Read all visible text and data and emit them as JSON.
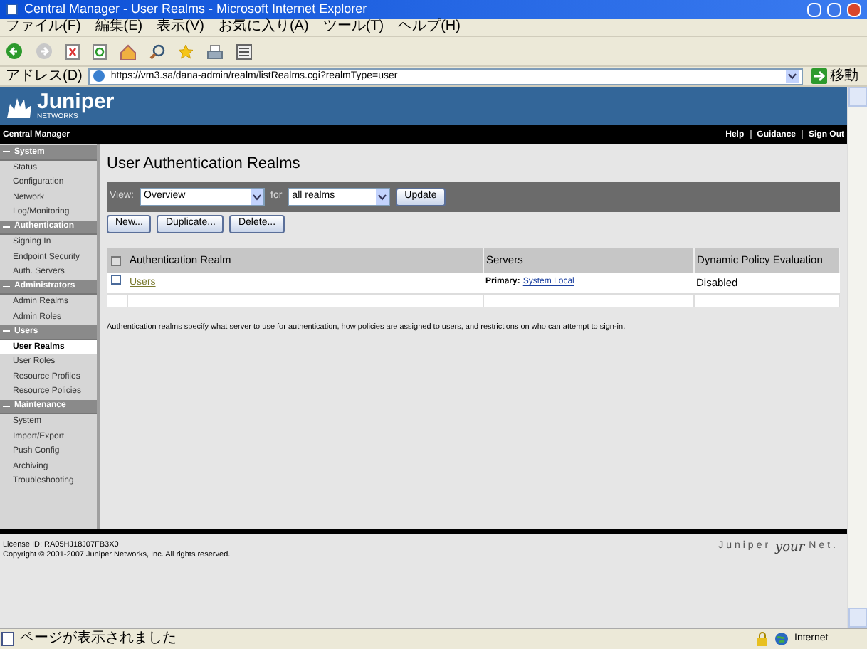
{
  "window": {
    "title": "Central Manager - User Realms - Microsoft Internet Explorer"
  },
  "menu_bar": [
    "ファイル(F)",
    "編集(E)",
    "表示(V)",
    "お気に入り(A)",
    "ツール(T)",
    "ヘルプ(H)"
  ],
  "address_bar": {
    "label": "アドレス(D)",
    "url": "https://vm3.sa/dana-admin/realm/listRealms.cgi?realmType=user",
    "go": "移動"
  },
  "header": {
    "logo": "Juniper",
    "logo_sub": "NETWORKS"
  },
  "nav_bar": {
    "title": "Central Manager",
    "links": [
      "Help",
      "Guidance",
      "Sign Out"
    ]
  },
  "sidebar": {
    "sections": [
      {
        "title": "System",
        "items": [
          {
            "label": "Status",
            "selected": false
          },
          {
            "label": "Configuration",
            "selected": false
          },
          {
            "label": "Network",
            "selected": false
          },
          {
            "label": "Log/Monitoring",
            "selected": false
          }
        ]
      },
      {
        "title": "Authentication",
        "items": [
          {
            "label": "Signing In",
            "selected": false
          },
          {
            "label": "Endpoint Security",
            "selected": false
          },
          {
            "label": "Auth. Servers",
            "selected": false
          }
        ]
      },
      {
        "title": "Administrators",
        "items": [
          {
            "label": "Admin Realms",
            "selected": false
          },
          {
            "label": "Admin Roles",
            "selected": false
          }
        ]
      },
      {
        "title": "Users",
        "items": [
          {
            "label": "User Realms",
            "selected": true
          },
          {
            "label": "User Roles",
            "selected": false
          },
          {
            "label": "Resource Profiles",
            "selected": false
          },
          {
            "label": "Resource Policies",
            "selected": false
          }
        ]
      },
      {
        "title": "Maintenance",
        "items": [
          {
            "label": "System",
            "selected": false
          },
          {
            "label": "Import/Export",
            "selected": false
          },
          {
            "label": "Push Config",
            "selected": false
          },
          {
            "label": "Archiving",
            "selected": false
          },
          {
            "label": "Troubleshooting",
            "selected": false
          }
        ]
      }
    ]
  },
  "page_title": "User Authentication Realms",
  "filter": {
    "view_label": "View:",
    "view_value": "Overview",
    "for_label": "for",
    "realm_value": "all realms",
    "update": "Update"
  },
  "buttons": [
    "New...",
    "Duplicate...",
    "Delete..."
  ],
  "table": {
    "columns": [
      "Authentication Realm",
      "Servers",
      "Dynamic Policy Evaluation"
    ],
    "rows": [
      {
        "realm": "Users",
        "servers_label": "Primary:",
        "server": "System Local",
        "evaluation": "Disabled",
        "checked": false
      }
    ]
  },
  "note": "Authentication realms specify what server to use for authentication, how policies are assigned to users, and restrictions on who can attempt to sign-in.",
  "footer": {
    "license": "License ID: RA05HJ18J07FB3X0",
    "copyright": "Copyright © 2001-2007 Juniper Networks, Inc. All rights reserved.",
    "brand": [
      "Juniper",
      "your",
      "Net."
    ]
  },
  "status_bar": {
    "text": "ページが表示されました",
    "zone": "Internet"
  }
}
